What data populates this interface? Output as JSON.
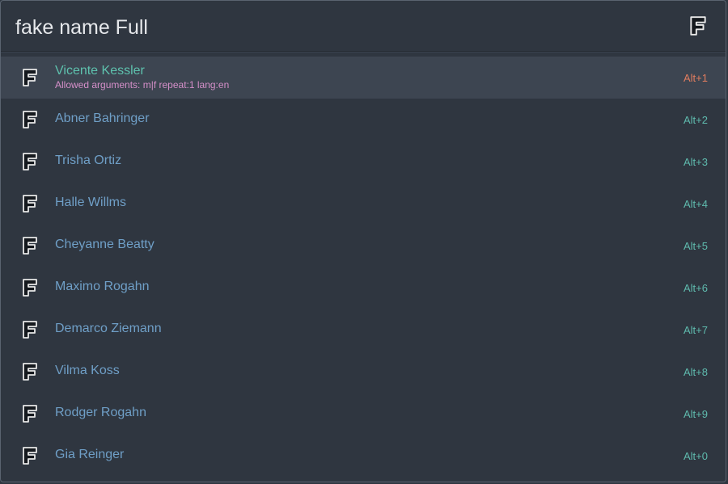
{
  "search": {
    "value": "fake name Full",
    "icon": "f-letter-icon"
  },
  "results": [
    {
      "title": "Vicente Kessler",
      "subtitle": "Allowed arguments: m|f repeat:1 lang:en",
      "shortcut": "Alt+1",
      "selected": true
    },
    {
      "title": "Abner Bahringer",
      "shortcut": "Alt+2"
    },
    {
      "title": "Trisha Ortiz",
      "shortcut": "Alt+3"
    },
    {
      "title": "Halle Willms",
      "shortcut": "Alt+4"
    },
    {
      "title": "Cheyanne Beatty",
      "shortcut": "Alt+5"
    },
    {
      "title": "Maximo Rogahn",
      "shortcut": "Alt+6"
    },
    {
      "title": "Demarco Ziemann",
      "shortcut": "Alt+7"
    },
    {
      "title": "Vilma Koss",
      "shortcut": "Alt+8"
    },
    {
      "title": "Rodger Rogahn",
      "shortcut": "Alt+9"
    },
    {
      "title": "Gia Reinger",
      "shortcut": "Alt+0"
    }
  ],
  "colors": {
    "background": "#2f3640",
    "selected_background": "#3d4551",
    "selected_title": "#5ec2ae",
    "title": "#6f9fc7",
    "subtitle": "#d58fc9",
    "shortcut": "#5fbbae",
    "selected_shortcut": "#e27d5f"
  }
}
